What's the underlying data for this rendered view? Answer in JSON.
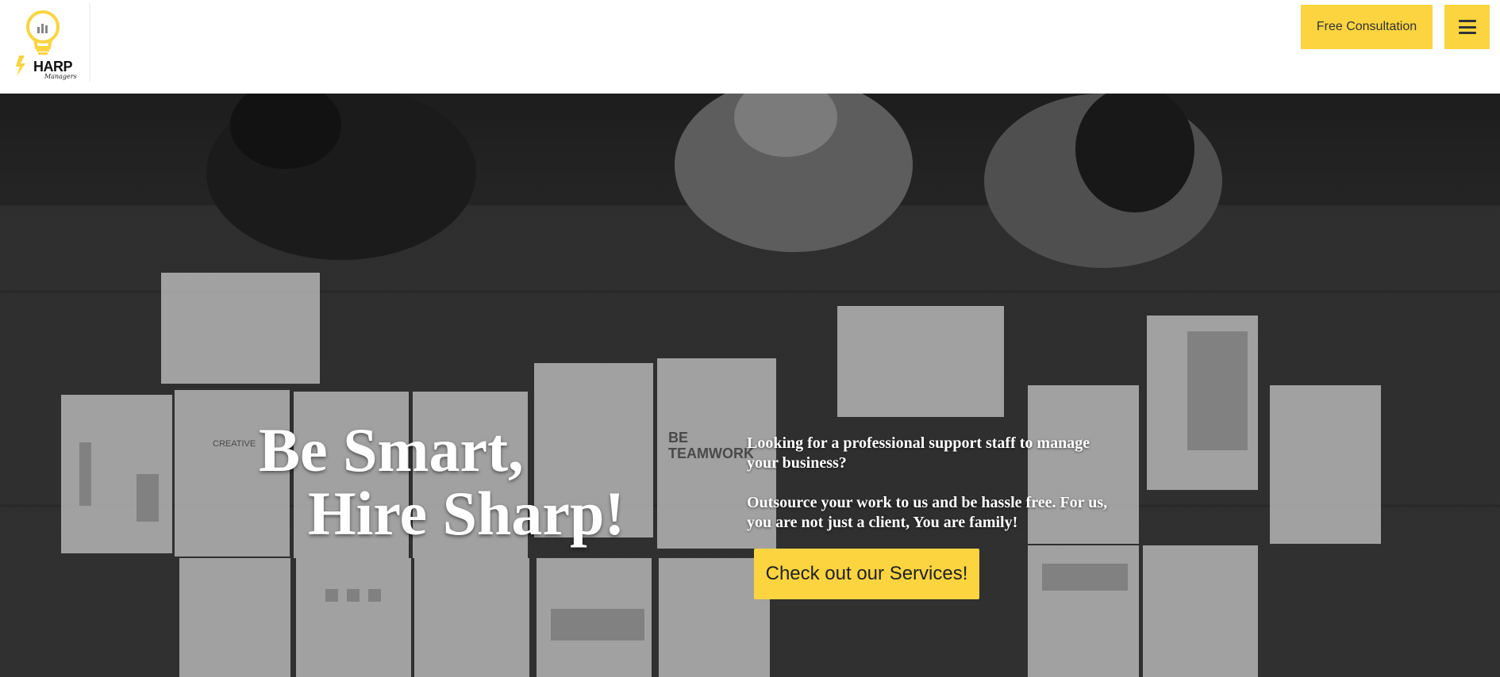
{
  "header": {
    "logo": {
      "icon": "lightbulb-logo-icon",
      "text": "HARP",
      "subtext": "Managers",
      "accent_color": "#fbd440"
    },
    "consult_label": "Free Consultation",
    "menu_icon": "hamburger-menu-icon"
  },
  "hero": {
    "headline_line1": "Be Smart,",
    "headline_line2": "Hire Sharp!",
    "intro_p1": "Looking for a professional support staff to manage your business?",
    "intro_p2": "Outsource your work to us and be hassle free. For us, you are not just a client, You are family!",
    "cta_label": "Check out our Services!",
    "background_image": "overhead-team-working-photo",
    "background_texts": {
      "creative": "CREATIVE",
      "teamwork_line1": "BE",
      "teamwork_line2": "TEAMWORK"
    }
  },
  "colors": {
    "accent": "#fbd440",
    "text_on_hero": "#ffffff",
    "header_bg": "#ffffff"
  }
}
